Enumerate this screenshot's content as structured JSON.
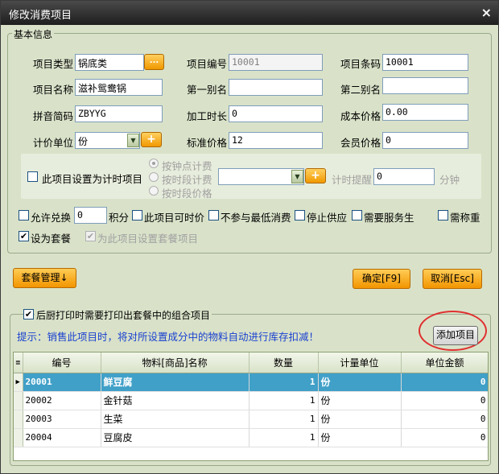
{
  "window": {
    "title": "修改消费项目",
    "close": "×"
  },
  "basic_group": {
    "label": "基本信息"
  },
  "fields": {
    "category": {
      "label": "项目类型",
      "value": "锅底类",
      "btn": "..."
    },
    "item_code": {
      "label": "项目编号",
      "value": "10001"
    },
    "barcode": {
      "label": "项目条码",
      "value": "10001"
    },
    "item_name": {
      "label": "项目名称",
      "value": "滋补鸳鸯锅"
    },
    "alias1": {
      "label": "第一别名",
      "value": ""
    },
    "alias2": {
      "label": "第二别名",
      "value": ""
    },
    "pinyin": {
      "label": "拼音简码",
      "value": "ZBYYG"
    },
    "process_time": {
      "label": "加工时长",
      "value": "0"
    },
    "cost_price": {
      "label": "成本价格",
      "value": "0.00"
    },
    "unit": {
      "label": "计价单位",
      "value": "份",
      "btn": "+"
    },
    "std_price": {
      "label": "标准价格",
      "value": "12"
    },
    "member_price": {
      "label": "会员价格",
      "value": "0"
    }
  },
  "timer": {
    "checkbox_label": "此项目设置为计时项目",
    "radio1": "按钟点计费",
    "radio2": "按时段计费",
    "radio3": "按时段价格",
    "select_value": "",
    "btn": "+",
    "reminder_label": "计时提醒",
    "reminder_value": "0",
    "unit": "分钟"
  },
  "options": {
    "allow_exchange": "允许兑换",
    "points_value": "0",
    "points_label": "积分",
    "market_price": "此项目可时价",
    "no_min_spend": "不参与最低消费",
    "stop_supply": "停止供应",
    "need_service": "需要服务生",
    "need_weigh": "需称重",
    "set_package": "设为套餐",
    "set_package_items": "为此项目设置套餐项目"
  },
  "buttons": {
    "package_mgmt": "套餐管理↓",
    "ok": "确定[F9]",
    "cancel": "取消[Esc]",
    "add_item": "添加项目"
  },
  "package_group": {
    "label": "后厨打印时需要打印出套餐中的组合项目"
  },
  "hint": "提示：销售此项目时，将对所设置成分中的物料自动进行库存扣减！",
  "table": {
    "headers": [
      "编号",
      "物料[商品]名称",
      "数量",
      "计量单位",
      "单位金额"
    ],
    "rows": [
      {
        "code": "20001",
        "name": "鲜豆腐",
        "qty": "1",
        "unit": "份",
        "amount": "0"
      },
      {
        "code": "20002",
        "name": "金针菇",
        "qty": "1",
        "unit": "份",
        "amount": "0"
      },
      {
        "code": "20003",
        "name": "生菜",
        "qty": "1",
        "unit": "份",
        "amount": "0"
      },
      {
        "code": "20004",
        "name": "豆腐皮",
        "qty": "1",
        "unit": "份",
        "amount": "0"
      }
    ]
  }
}
